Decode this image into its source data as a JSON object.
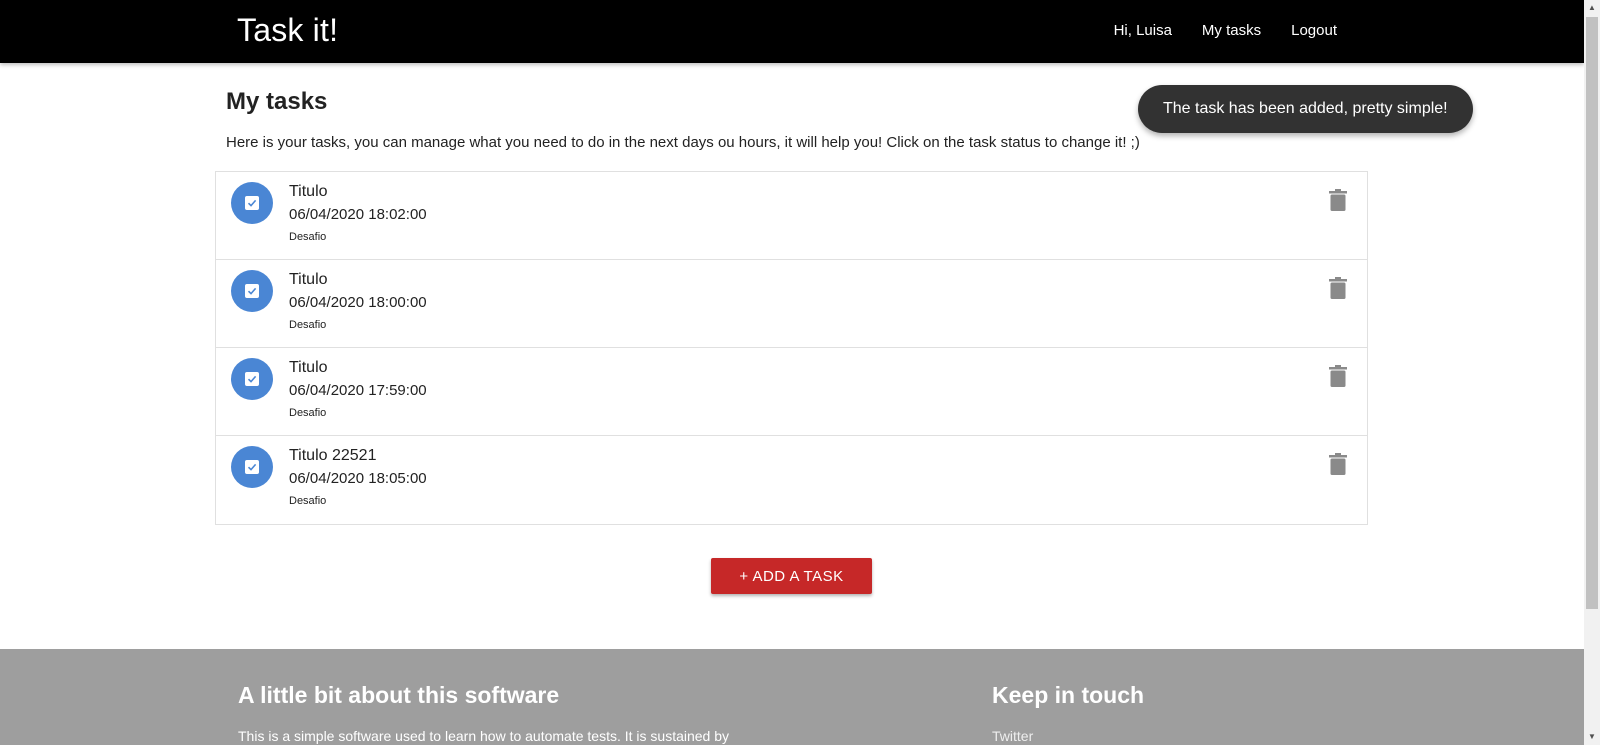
{
  "header": {
    "brand": "Task it!",
    "nav": [
      "Hi, Luisa",
      "My tasks",
      "Logout"
    ]
  },
  "page": {
    "title": "My tasks",
    "description": "Here is your tasks, you can manage what you need to do in the next days ou hours, it will help you! Click on the task status to change it! ;)"
  },
  "tasks": [
    {
      "title": "Titulo",
      "datetime": "06/04/2020 18:02:00",
      "tag": "Desafio",
      "status": "done"
    },
    {
      "title": "Titulo",
      "datetime": "06/04/2020 18:00:00",
      "tag": "Desafio",
      "status": "done"
    },
    {
      "title": "Titulo",
      "datetime": "06/04/2020 17:59:00",
      "tag": "Desafio",
      "status": "done"
    },
    {
      "title": "Titulo 22521",
      "datetime": "06/04/2020 18:05:00",
      "tag": "Desafio",
      "status": "done"
    }
  ],
  "add_button": "+ ADD A TASK",
  "toast": "The task has been added, pretty simple!",
  "footer": {
    "about_title": "A little bit about this software",
    "about_text": "This is a simple software used to learn how to automate tests. It is sustained by",
    "touch_title": "Keep in touch",
    "links": [
      "Twitter"
    ]
  },
  "colors": {
    "header_bg": "#000000",
    "status_accent": "#4a86d4",
    "add_button": "#c62828",
    "footer_bg": "#9e9e9e",
    "toast_bg": "#323232"
  },
  "icons": {
    "status": "checkbox-checked-icon",
    "delete": "trash-icon"
  }
}
